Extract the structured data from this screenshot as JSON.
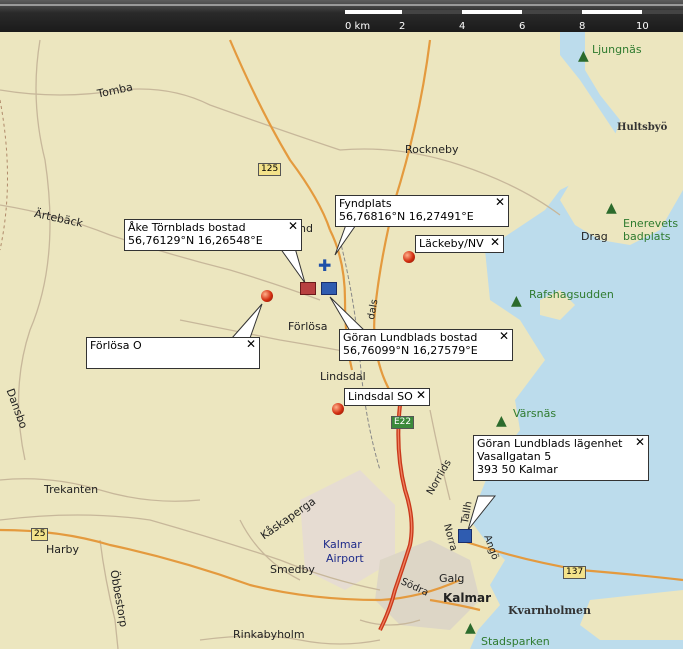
{
  "scale": {
    "unit_label": "0 km",
    "ticks": [
      "2",
      "4",
      "6",
      "8",
      "10"
    ]
  },
  "places": {
    "ljungnas": "Ljungnäs",
    "hultsbyo": "Hultsbyö",
    "tomba": "Tomba",
    "rockneby": "Rockneby",
    "artebäck": "Ärtebäck",
    "nd": "nd",
    "enerevets": "Enerevets",
    "badplats": "badplats",
    "drag": "Drag",
    "rafshagsudden": "Rafshagsudden",
    "forlosa": "Förlösa",
    "lindsdal": "Lindsdal",
    "varsnas": "Värsnäs",
    "dansbo": "Dansbo",
    "trekanten": "Trekanten",
    "harby": "Harby",
    "obbestorp": "Öbbestorp",
    "kaskaperga": "Kåskaperga",
    "kalmar_airport_1": "Kalmar",
    "kalmar_airport_2": "Airport",
    "smedby": "Smedby",
    "kalmar": "Kalmar",
    "kvarnholmen": "Kvarnholmen",
    "stadsparken": "Stadsparken",
    "rinkabyholm": "Rinkabyholm",
    "galg": "Galg",
    "norra": "Norra",
    "norrlids": "Norrlids",
    "tallh": "Tallh",
    "ango": "Angö",
    "sodra": "Södra",
    "dals": "dals"
  },
  "road_shields": {
    "r125": "125",
    "e22": "E22",
    "r25": "25",
    "r137": "137"
  },
  "popups": {
    "fyndplats": {
      "title": "Fyndplats",
      "coords": "56,76816°N 16,27491°E"
    },
    "ake": {
      "title": "Åke Törnblads bostad",
      "coords": "56,76129°N 16,26548°E"
    },
    "lackeby": {
      "title": "Läckeby/NV"
    },
    "goran_bostad": {
      "title": "Göran Lundblads bostad",
      "coords": "56,76099°N 16,27579°E"
    },
    "forlosa_o": {
      "title": "Förlösa O"
    },
    "lindsdal_so": {
      "title": "Lindsdal SO"
    },
    "goran_lagenhet": {
      "title": "Göran Lundblads lägenhet",
      "line2": "Vasallgatan 5",
      "line3": "393 50 Kalmar"
    },
    "close_glyph": "✕"
  },
  "colors": {
    "land": "#ece6bf",
    "water": "#bcdcec",
    "road_major": "#e49a3e",
    "e22": "#c9381a",
    "forest_text": "#2f7b2f"
  }
}
